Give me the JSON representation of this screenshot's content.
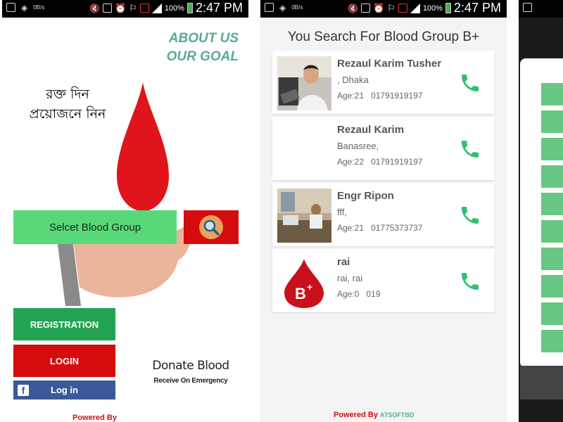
{
  "status_bar": {
    "left_icons": [
      "image-icon",
      "location-icon",
      "data-rate-icon"
    ],
    "data_rate": "0B/s",
    "right_icons": [
      "mute-icon",
      "nfc-icon",
      "alarm-icon",
      "wifi-icon",
      "notification-icon",
      "signal-icon"
    ],
    "battery": "100%",
    "time": "2:47 PM"
  },
  "home_screen": {
    "about_us": "ABOUT US",
    "our_goal": "OUR GOAL",
    "slogan_line1": "রক্ত দিন",
    "slogan_line2": "প্রয়োজনে নিন",
    "select_blood_group": "Selcet Blood Group",
    "registration": "REGISTRATION",
    "login": "LOGIN",
    "facebook_login": "Log in",
    "donate_blood": "Donate Blood",
    "receive_on_emergency": "Receive On Emergency",
    "powered_by": "Powered By"
  },
  "results_screen": {
    "title": "You Search For Blood Group B+",
    "donors": [
      {
        "name": "Rezaul Karim Tusher",
        "address": ",  Dhaka",
        "age": "Age:21",
        "phone": "01791919197",
        "photo": "person-photo"
      },
      {
        "name": "Rezaul Karim",
        "address": "Banasree,",
        "age": "Age:22",
        "phone": "01791919197",
        "photo": "none"
      },
      {
        "name": "Engr Ripon",
        "address": "fff,",
        "age": "Age:21",
        "phone": "01775373737",
        "photo": "office-photo"
      },
      {
        "name": "rai",
        "address": "rai,  rai",
        "age": "Age:0",
        "phone": "019",
        "photo": "blood-drop-bplus"
      }
    ],
    "drop_label": "B",
    "drop_sup": "+",
    "powered_by": "Powered By",
    "company": "ATSOFTBD"
  },
  "colors": {
    "green": "#57d97a",
    "dark_green": "#23a455",
    "red": "#d40c0c",
    "facebook_blue": "#3b5998",
    "teal_text": "#5aa89a",
    "call_green": "#2fbf71"
  }
}
